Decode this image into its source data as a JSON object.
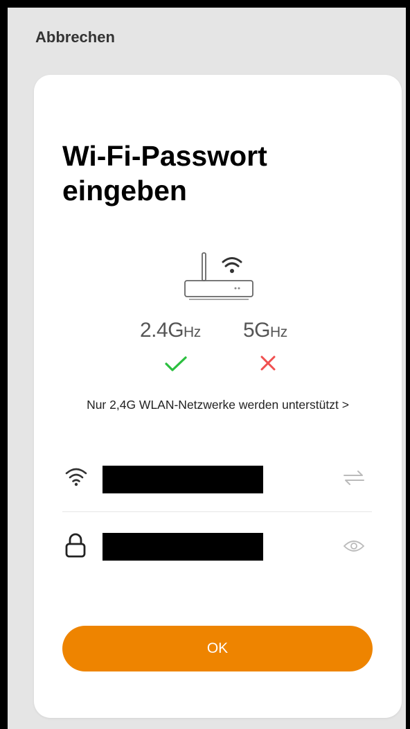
{
  "header": {
    "cancel_label": "Abbrechen"
  },
  "dialog": {
    "title": "Wi-Fi-Passwort eingeben",
    "band_24": {
      "value": "2.4G",
      "unit": "Hz",
      "supported": true
    },
    "band_5": {
      "value": "5G",
      "unit": "Hz",
      "supported": false
    },
    "notice": "Nur 2,4G WLAN-Netzwerke werden unterstützt",
    "notice_arrow": ">",
    "wifi_field": {
      "icon": "wifi-icon",
      "value_redacted": true,
      "action_icon": "swap-arrows-icon"
    },
    "password_field": {
      "icon": "lock-icon",
      "value_redacted": true,
      "action_icon": "eye-icon"
    },
    "ok_label": "OK"
  },
  "colors": {
    "accent": "#ee8400",
    "check": "#2bbf3f",
    "cross": "#f05050",
    "background": "#e5e5e5",
    "card": "#ffffff"
  }
}
